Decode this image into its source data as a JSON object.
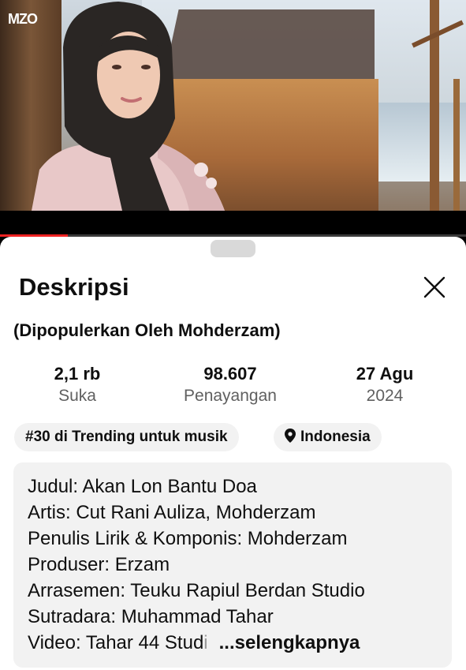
{
  "video": {
    "channel_logo": "MZO",
    "progress_percent": 14.5
  },
  "sheet": {
    "title": "Deskripsi",
    "close_icon": "close-icon",
    "subtitle": "(Dipopulerkan Oleh Mohderzam)",
    "stats": {
      "likes_value": "2,1 rb",
      "likes_label": "Suka",
      "views_value": "98.607",
      "views_label": "Penayangan",
      "date_value": "27 Agu",
      "date_label": "2024"
    },
    "chips": {
      "trending": "#30 di Trending untuk musik",
      "location": "Indonesia",
      "location_icon": "location-pin-icon"
    },
    "description": {
      "lines": [
        "Judul: Akan Lon Bantu Doa",
        "Artis: Cut Rani Auliza, Mohderzam",
        "Penulis Lirik & Komponis: Mohderzam",
        "Produser: Erzam",
        "Arrasemen: Teuku Rapiul Berdan Studio",
        "Sutradara: Muhammad Tahar"
      ],
      "last_line_visible": "Video: Tahar 44 Stud",
      "last_line_faded": "i",
      "more_label": "...selengkapnya"
    }
  }
}
